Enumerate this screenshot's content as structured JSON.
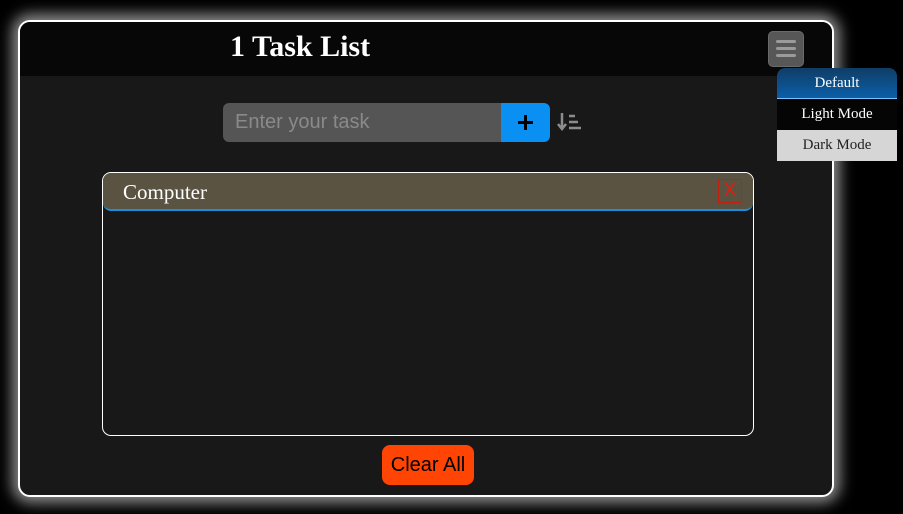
{
  "header": {
    "title": "1 Task List",
    "menu_icon": "hamburger-menu-icon"
  },
  "task_form": {
    "input_placeholder": "Enter your task",
    "input_value": "",
    "add_icon": "plus-icon",
    "sort_icon": "sort-descending-icon"
  },
  "tasks": [
    {
      "text": "Computer",
      "delete_label": "X"
    }
  ],
  "actions": {
    "clear_all_label": "Clear All"
  },
  "theme_menu": {
    "options": [
      {
        "label": "Default",
        "active": true
      },
      {
        "label": "Light Mode",
        "active": false
      },
      {
        "label": "Dark Mode",
        "active": false
      }
    ]
  },
  "colors": {
    "accent_blue": "#0a8ff2",
    "clear_button": "#ff4404",
    "delete_red": "#e81a0a",
    "task_background": "#5a5342",
    "card_background": "#181818"
  }
}
